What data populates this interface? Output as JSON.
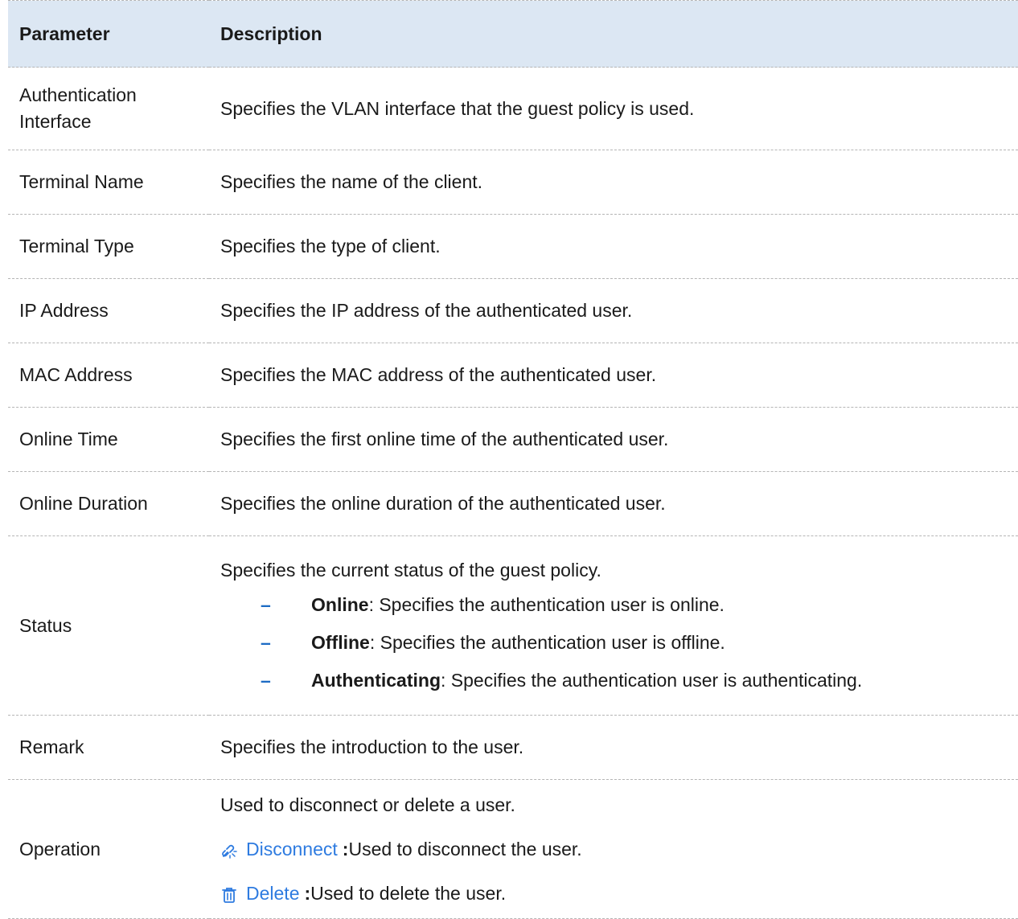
{
  "table": {
    "headers": [
      "Parameter",
      "Description"
    ],
    "rows": [
      {
        "param": "Authentication Interface",
        "desc": "Specifies the VLAN interface that the guest policy is used."
      },
      {
        "param": "Terminal Name",
        "desc": "Specifies the name of the client."
      },
      {
        "param": "Terminal Type",
        "desc": "Specifies the type of client."
      },
      {
        "param": "IP Address",
        "desc": "Specifies the IP address of the authenticated user."
      },
      {
        "param": "MAC Address",
        "desc": "Specifies the MAC address of the authenticated user."
      },
      {
        "param": "Online Time",
        "desc": "Specifies the first online time of the authenticated user."
      },
      {
        "param": "Online Duration",
        "desc": "Specifies the online duration of the authenticated user."
      }
    ],
    "status": {
      "param": "Status",
      "desc": "Specifies the current status of the guest policy.",
      "dash": "–",
      "items": [
        {
          "term": "Online",
          "text": ": Specifies the authentication user is online."
        },
        {
          "term": "Offline",
          "text": ": Specifies the authentication user is offline."
        },
        {
          "term": "Authenticating",
          "text": ": Specifies the authentication user is authenticating."
        }
      ]
    },
    "remark": {
      "param": "Remark",
      "desc": "Specifies the introduction to the user."
    },
    "operation": {
      "param": "Operation",
      "desc": "Used to disconnect or delete a user.",
      "disconnect": {
        "label": "Disconnect",
        "sep": " : ",
        "text": "Used to disconnect the user.",
        "icon": "unlink-icon"
      },
      "delete": {
        "label": "Delete",
        "sep": ": ",
        "text": "Used to delete the user.",
        "icon": "trash-icon"
      }
    }
  },
  "colors": {
    "header_bg": "#dce7f3",
    "accent": "#2e7be0",
    "dash": "#1c6bc4"
  }
}
